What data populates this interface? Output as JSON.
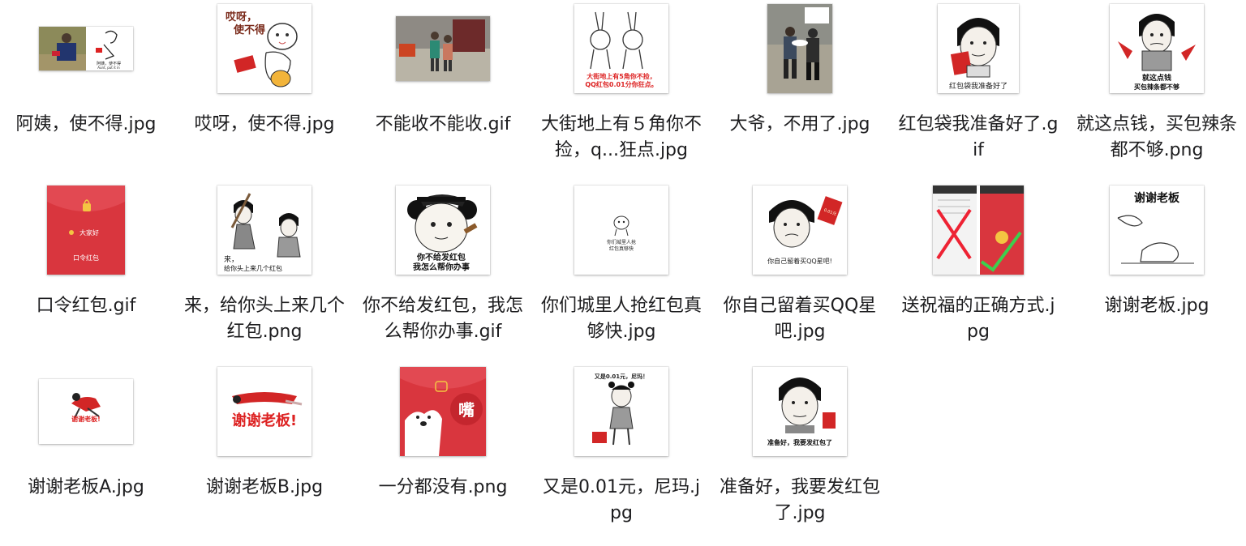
{
  "files": [
    {
      "name": "阿姨，使不得.jpg",
      "icon": "photo-thumbnail"
    },
    {
      "name": "哎呀，使不得.jpg",
      "icon": "cartoon-thumbnail"
    },
    {
      "name": "不能收不能收.gif",
      "icon": "photo-thumbnail"
    },
    {
      "name": "大街地上有５角你不捡，q...狂点.jpg",
      "icon": "cartoon-thumbnail"
    },
    {
      "name": "大爷，不用了.jpg",
      "icon": "photo-thumbnail"
    },
    {
      "name": "红包袋我准备好了.gif",
      "icon": "meme-face-thumbnail"
    },
    {
      "name": "就这点钱，买包辣条都不够.png",
      "icon": "meme-face-thumbnail"
    },
    {
      "name": "口令红包.gif",
      "icon": "red-envelope-thumbnail"
    },
    {
      "name": "来，给你头上来几个红包.png",
      "icon": "cartoon-thumbnail"
    },
    {
      "name": "你不给发红包，我怎么帮你办事.gif",
      "icon": "panda-meme-thumbnail"
    },
    {
      "name": "你们城里人抢红包真够快.jpg",
      "icon": "cartoon-thumbnail"
    },
    {
      "name": "你自己留着买QQ星吧.jpg",
      "icon": "meme-face-thumbnail"
    },
    {
      "name": "送祝福的正确方式.jpg",
      "icon": "screenshot-thumbnail"
    },
    {
      "name": "谢谢老板.jpg",
      "icon": "cartoon-thumbnail"
    },
    {
      "name": "谢谢老板A.jpg",
      "icon": "cartoon-thumbnail"
    },
    {
      "name": "谢谢老板B.jpg",
      "icon": "cartoon-thumbnail"
    },
    {
      "name": "一分都没有.png",
      "icon": "red-envelope-thumbnail"
    },
    {
      "name": "又是0.01元，尼玛.jpg",
      "icon": "cartoon-thumbnail"
    },
    {
      "name": "准备好，我要发红包了.jpg",
      "icon": "meme-face-thumbnail"
    }
  ],
  "thumb_text": {
    "t0": "阿姨，使不得\nAunt, put it in",
    "t1": "哎呀，\n使不得",
    "t3a": "大街地上有5角你不捡，",
    "t3b": "QQ红包0.01分你狂点。",
    "t5": "红包袋我准备好了",
    "t6a": "就这点钱",
    "t6b": "买包辣条都不够",
    "t7a": "大家好",
    "t7b": "口令红包",
    "t8a": "来，",
    "t8b": "给你头上来几个红包",
    "t9a": "你不给发红包",
    "t9b": "我怎么帮你办事",
    "t10a": "你们城里人抢",
    "t10b": "红包真够快",
    "t11a": "你自己留着买QQ星吧!",
    "t11b": "0.01元",
    "t13": "谢谢老板",
    "t14": "谢谢老板!",
    "t15": "谢谢老板!",
    "t16": "嘴",
    "t17": "又是0.01元，尼玛！",
    "t18": "准备好，我要发红包了"
  },
  "colors": {
    "envelope_red": "#d9363e",
    "envelope_gold": "#f4c542",
    "label_text": "#1d1d1f"
  }
}
